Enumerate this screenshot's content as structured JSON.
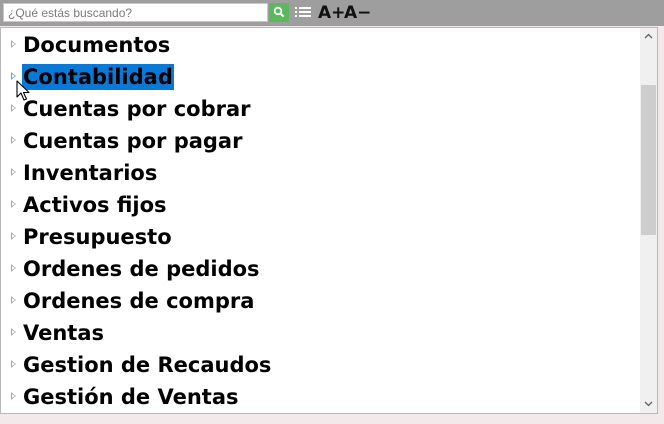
{
  "search": {
    "placeholder": "¿Qué estás buscando?",
    "value": ""
  },
  "toolbar": {
    "font_increase_label": "A+",
    "font_decrease_label": "A−"
  },
  "tree": {
    "selected_index": 1,
    "items": [
      {
        "label": "Documentos"
      },
      {
        "label": "Contabilidad"
      },
      {
        "label": "Cuentas por cobrar"
      },
      {
        "label": "Cuentas por pagar"
      },
      {
        "label": "Inventarios"
      },
      {
        "label": "Activos fijos"
      },
      {
        "label": "Presupuesto"
      },
      {
        "label": "Ordenes de pedidos"
      },
      {
        "label": "Ordenes de compra"
      },
      {
        "label": "Ventas"
      },
      {
        "label": "Gestion de Recaudos"
      },
      {
        "label": "Gestión de Ventas"
      }
    ]
  },
  "icons": {
    "search_button": "search-icon",
    "list_button": "list-icon",
    "expander": "triangle-right-icon",
    "scroll_up": "chevron-up-icon",
    "scroll_down": "chevron-down-icon",
    "cursor": "mouse-pointer-icon"
  },
  "colors": {
    "toolbar_bg": "#9e9e9e",
    "search_button_bg": "#5cb85c",
    "selection_bg": "#0a78d7",
    "page_bg": "#f3e9ea"
  }
}
